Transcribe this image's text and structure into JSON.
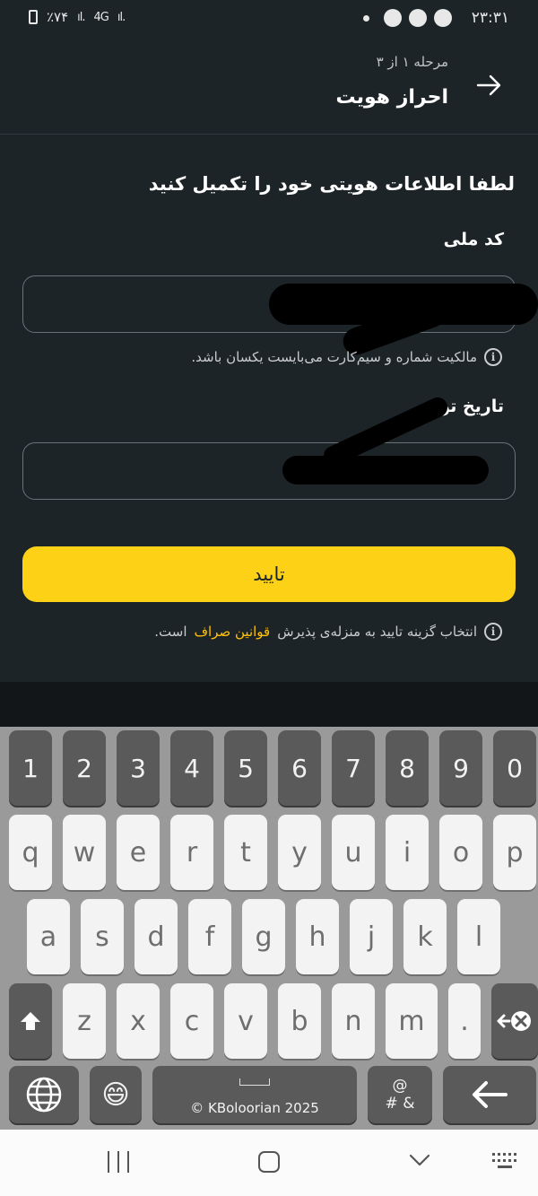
{
  "status_bar": {
    "time": "۲۳:۳۱",
    "battery": "٪۷۴",
    "network": "4G"
  },
  "header": {
    "step_text": "مرحله ۱ از ۳",
    "title": "احراز هویت"
  },
  "form": {
    "prompt": "لطفا اطلاعات هویتی خود را تکمیل کنید",
    "national_code": {
      "label": "کد ملی",
      "hint": "مالکیت شماره و سیم‌کارت می‌بایست یکسان باشد."
    },
    "birth_date": {
      "label": "تاریخ تولد"
    },
    "confirm_label": "تایید",
    "terms_prefix": "انتخاب گزینه تایید به منزله‌ی پذیرش",
    "terms_link": "قوانین صراف",
    "terms_suffix": "است."
  },
  "keyboard": {
    "numbers": [
      "1",
      "2",
      "3",
      "4",
      "5",
      "6",
      "7",
      "8",
      "9",
      "0"
    ],
    "row1": [
      "q",
      "w",
      "e",
      "r",
      "t",
      "y",
      "u",
      "i",
      "o",
      "p"
    ],
    "row2": [
      "a",
      "s",
      "d",
      "f",
      "g",
      "h",
      "j",
      "k",
      "l"
    ],
    "row3": [
      "z",
      "x",
      "c",
      "v",
      "b",
      "n",
      "m",
      "."
    ],
    "space_label": "KBoloorian 2025",
    "symbols_top": "@",
    "symbols_bottom": "# &",
    "emoji": "😄"
  },
  "colors": {
    "background": "#1d2428",
    "accent": "#fcd116",
    "link": "#ffc107"
  }
}
